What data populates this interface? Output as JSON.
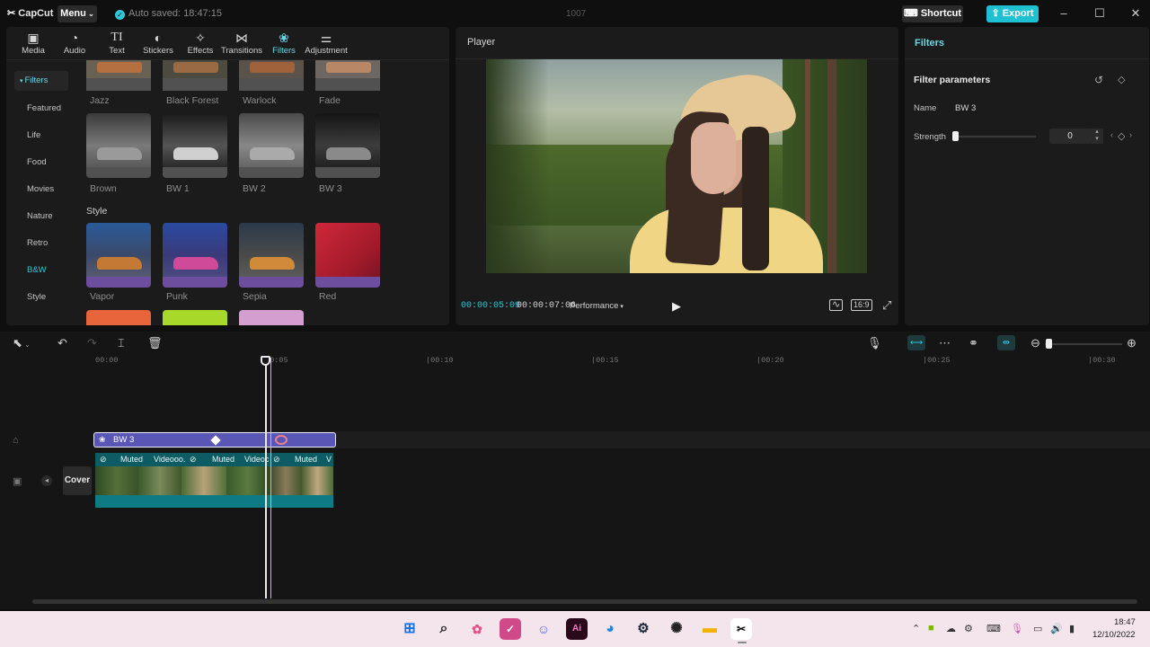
{
  "app": {
    "logo": "CapCut",
    "menu_label": "Menu",
    "autosave": "Auto saved: 18:47:15",
    "project_name": "1007",
    "shortcut_label": "Shortcut",
    "export_label": "Export",
    "accent": "#20c0d3"
  },
  "tabs": [
    {
      "label": "Media",
      "icon": "media-icon"
    },
    {
      "label": "Audio",
      "icon": "audio-icon"
    },
    {
      "label": "Text",
      "icon": "text-icon"
    },
    {
      "label": "Stickers",
      "icon": "stickers-icon"
    },
    {
      "label": "Effects",
      "icon": "effects-icon"
    },
    {
      "label": "Transitions",
      "icon": "transitions-icon"
    },
    {
      "label": "Filters",
      "icon": "filters-icon",
      "active": true
    },
    {
      "label": "Adjustment",
      "icon": "adjustment-icon"
    }
  ],
  "categories": [
    "Filters",
    "Featured",
    "Life",
    "Food",
    "Movies",
    "Nature",
    "Retro",
    "B&W",
    "Style"
  ],
  "filters": {
    "row0": [
      "Jazz",
      "Black Forest",
      "Warlock",
      "Fade"
    ],
    "row1": [
      "Brown",
      "BW 1",
      "BW 2",
      "BW 3"
    ],
    "style_heading": "Style",
    "row2": [
      "Vapor",
      "Punk",
      "Sepia",
      "Red"
    ]
  },
  "player": {
    "title": "Player",
    "current_time": "00:00:05:09",
    "total_time": "00:00:07:06",
    "quality": "Performance",
    "ratio": "16:9"
  },
  "right_panel": {
    "title": "Filters",
    "section": "Filter parameters",
    "name_label": "Name",
    "name_value": "BW 3",
    "strength_label": "Strength",
    "strength_value": "0",
    "strength_fraction": 0
  },
  "timeline": {
    "ticks": [
      "00:00",
      "|00:05",
      "|00:10",
      "|00:15",
      "|00:20",
      "|00:25",
      "|00:30"
    ],
    "filter_clip_label": "BW 3",
    "video_segments": [
      "Muted",
      "Videooo.",
      "Muted",
      "Videoc",
      "Muted",
      "V"
    ],
    "cover_label": "Cover"
  },
  "taskbar": {
    "time": "18:47",
    "date": "12/10/2022"
  }
}
